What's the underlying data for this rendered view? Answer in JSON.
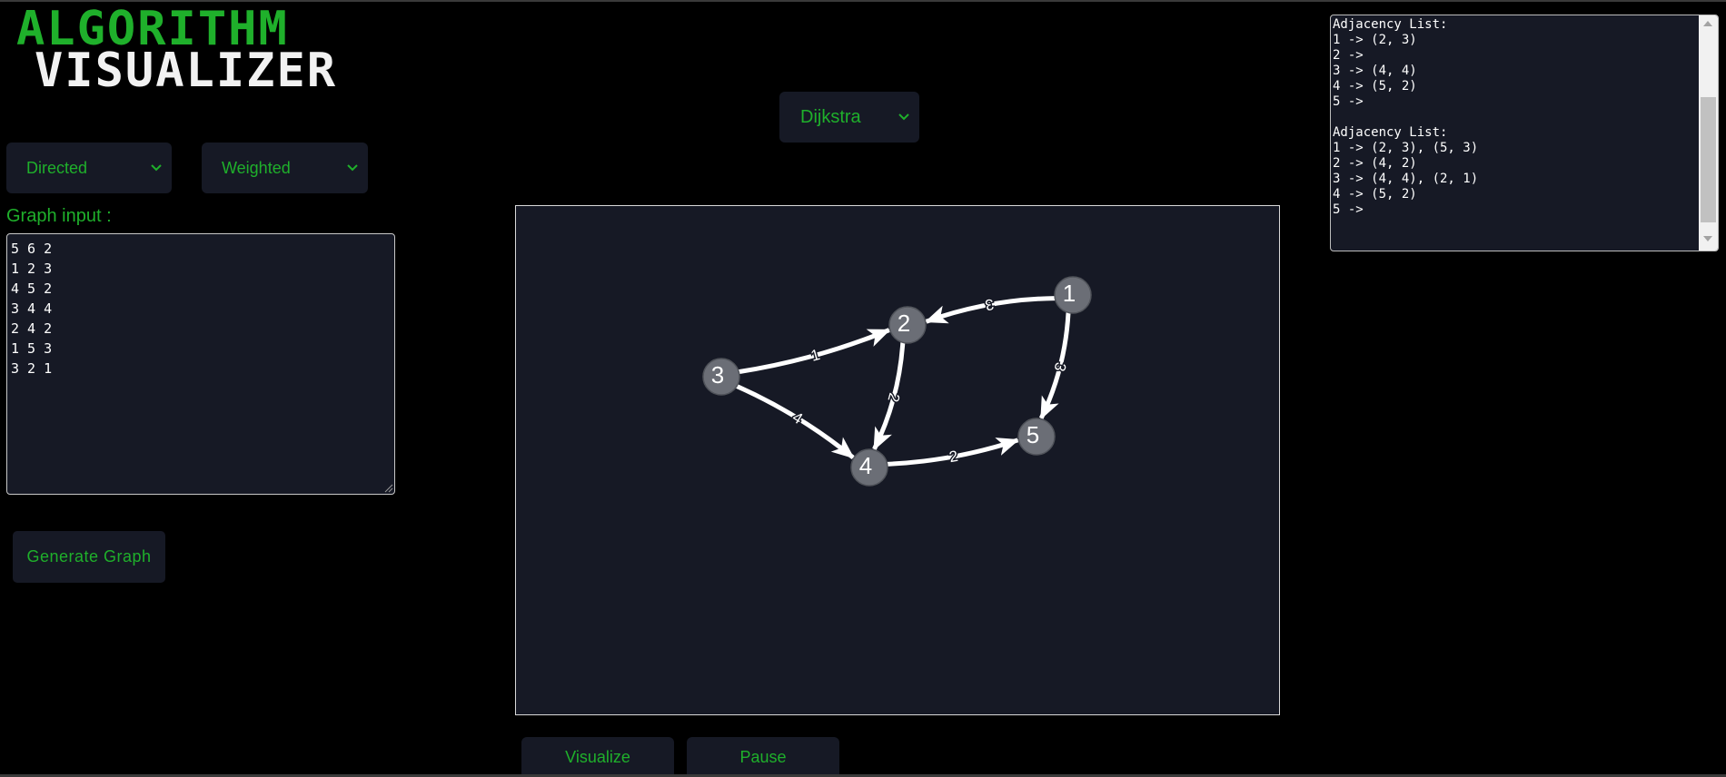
{
  "logo": {
    "line1": "ALGORITHM",
    "line2": "VISUALIZER"
  },
  "controls": {
    "direction_value": "Directed",
    "weight_value": "Weighted",
    "algorithm_value": "Dijkstra",
    "graph_input_label": "Graph input :",
    "graph_input_value": "5 6 2\n1 2 3\n4 5 2\n3 4 4\n2 4 2\n1 5 3\n3 2 1",
    "generate_label": "Generate Graph",
    "visualize_label": "Visualize",
    "pause_label": "Pause"
  },
  "adjacency_output": "Adjacency List:\n1 -> (2, 3)\n2 ->\n3 -> (4, 4)\n4 -> (5, 2)\n5 ->\n\nAdjacency List:\n1 -> (2, 3), (5, 3)\n2 -> (4, 2)\n3 -> (4, 4), (2, 1)\n4 -> (5, 2)\n5 ->",
  "graph": {
    "nodes": [
      "1",
      "2",
      "3",
      "4",
      "5"
    ],
    "edges": [
      {
        "from": "1",
        "to": "2",
        "weight": "3"
      },
      {
        "from": "4",
        "to": "5",
        "weight": "2"
      },
      {
        "from": "3",
        "to": "4",
        "weight": "4"
      },
      {
        "from": "2",
        "to": "4",
        "weight": "2"
      },
      {
        "from": "1",
        "to": "5",
        "weight": "3"
      },
      {
        "from": "3",
        "to": "2",
        "weight": "1"
      }
    ]
  },
  "colors": {
    "accent": "#1fb02b",
    "panel": "#161925",
    "node_fill": "#6b6e76",
    "edge": "#ffffff"
  }
}
